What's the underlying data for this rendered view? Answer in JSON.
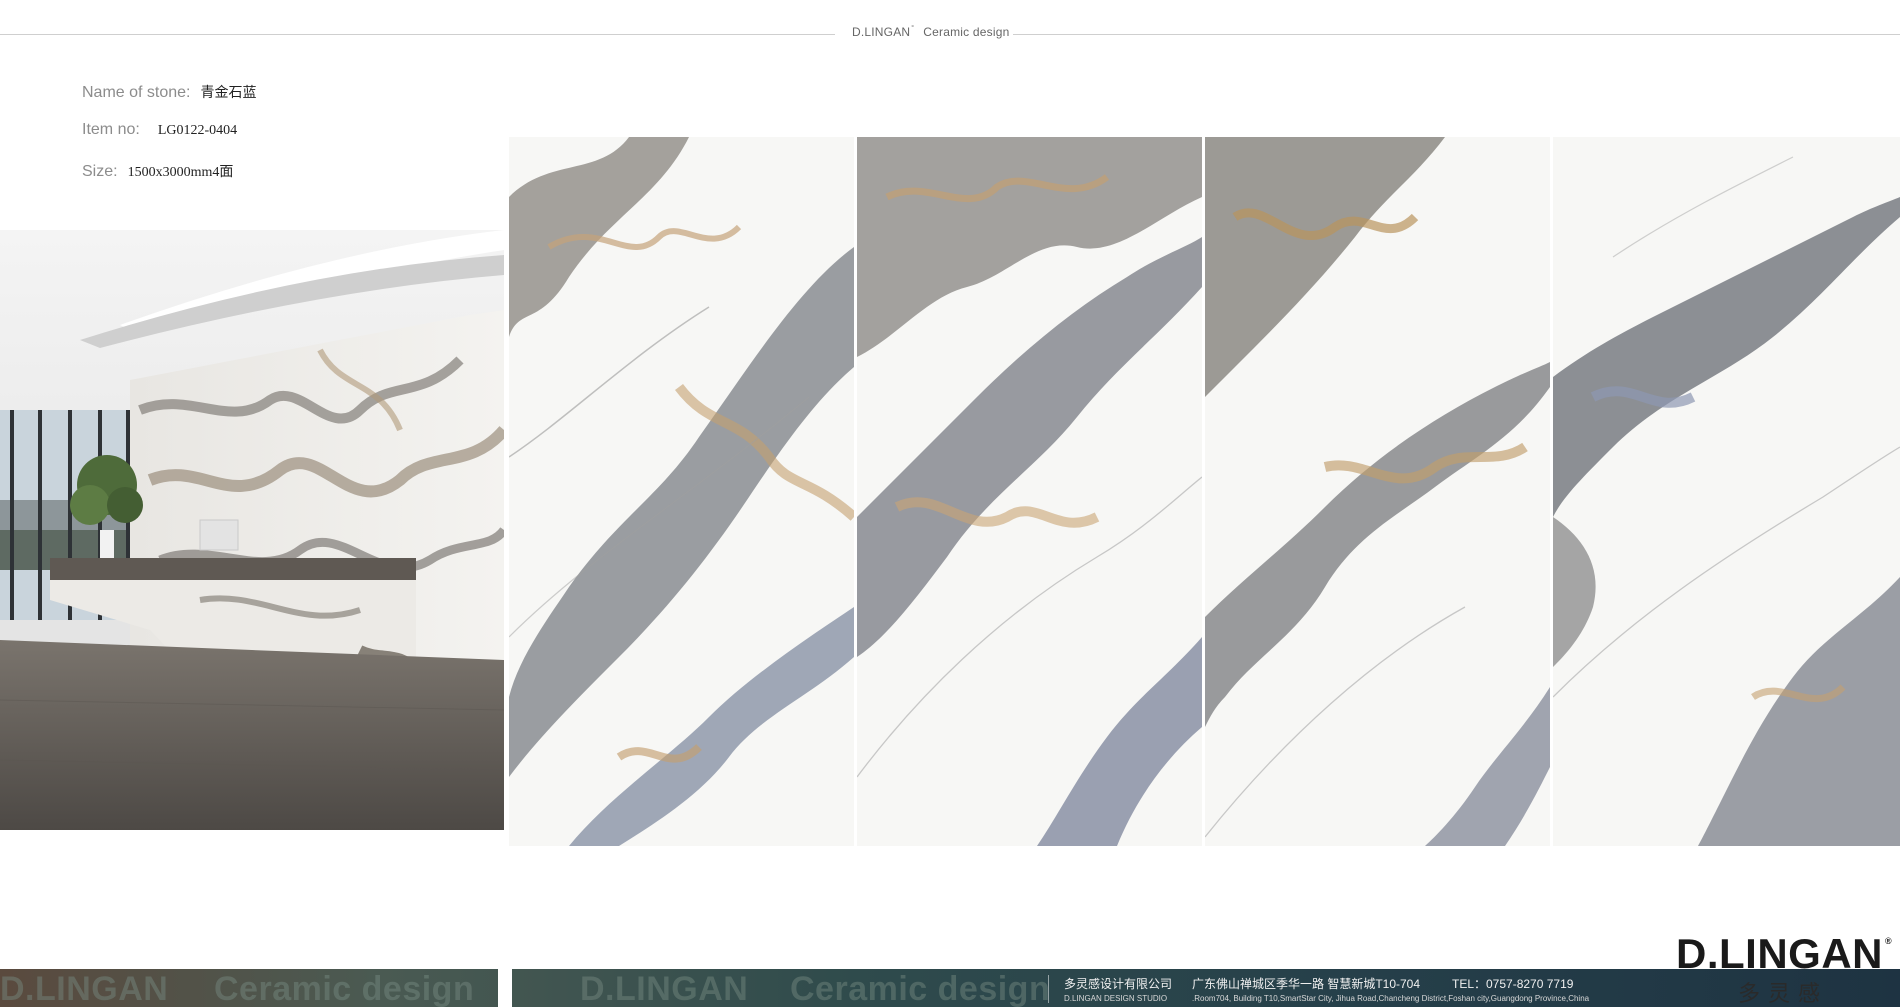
{
  "header": {
    "brand": "D.LINGAN",
    "registered": "°",
    "subtitle": "Ceramic design"
  },
  "specs": {
    "name_label": "Name  of stone:",
    "name_value": "青金石蓝",
    "item_label": "Item no:",
    "item_value": "LG0122-0404",
    "size_label": "Size:",
    "size_value": "1500x3000mm4面"
  },
  "footer": {
    "watermark_brand": "D.LINGAN",
    "watermark_subtitle": "Ceramic design",
    "company_cn": "多灵感设计有限公司",
    "company_en": "D.LINGAN DESIGN STUDIO",
    "address_cn": "广东佛山禅城区季华一路  智慧新城T10-704",
    "address_en": ".Room704, Building T10,SmartStar City, Jihua Road,Chancheng  District,Foshan  city,Guangdong Province,China",
    "tel": "TEL：0757-8270 7719"
  },
  "logo": {
    "text": "D.LINGAN",
    "registered": "®",
    "cn": "多灵感"
  },
  "colors": {
    "vein_gray": "#7a7b7c",
    "vein_gold": "#c4a070",
    "vein_blue": "#8a95b0",
    "slab_white": "#f6f6f4"
  }
}
